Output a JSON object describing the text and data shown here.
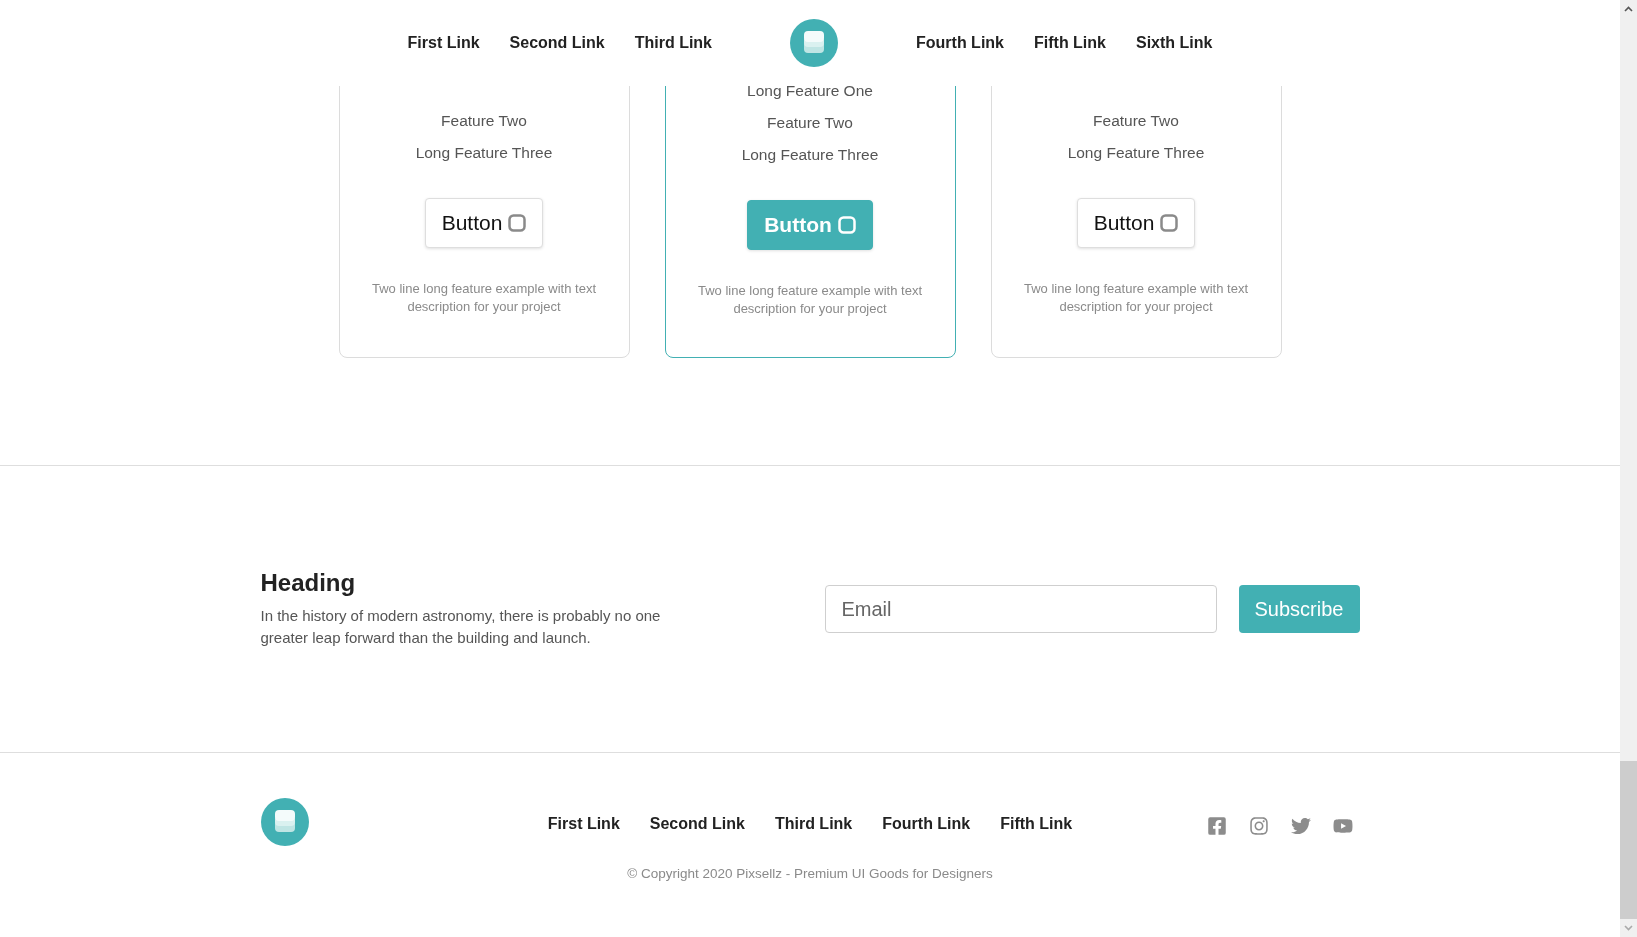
{
  "nav": {
    "left_links": [
      "First Link",
      "Second Link",
      "Third Link"
    ],
    "right_links": [
      "Fourth Link",
      "Fifth Link",
      "Sixth Link"
    ]
  },
  "plans": [
    {
      "features": [
        "Feature Two",
        "Long Feature Three"
      ],
      "button": "Button",
      "description": "Two line long feature example with text description for your project",
      "selected": false
    },
    {
      "features": [
        "Long Feature One",
        "Feature Two",
        "Long Feature Three"
      ],
      "button": "Button",
      "description": "Two line long feature example with text description for your project",
      "selected": true
    },
    {
      "features": [
        "Feature Two",
        "Long Feature Three"
      ],
      "button": "Button",
      "description": "Two line long feature example with text description for your project",
      "selected": false
    }
  ],
  "newsletter": {
    "heading": "Heading",
    "text": "In the history of modern astronomy, there is probably no one greater leap forward than the building and launch.",
    "email_placeholder": "Email",
    "button": "Subscribe"
  },
  "footer": {
    "links": [
      "First Link",
      "Second Link",
      "Third Link",
      "Fourth Link",
      "Fifth Link"
    ],
    "copyright": "© Copyright 2020 Pixsellz - Premium UI Goods for Designers"
  }
}
